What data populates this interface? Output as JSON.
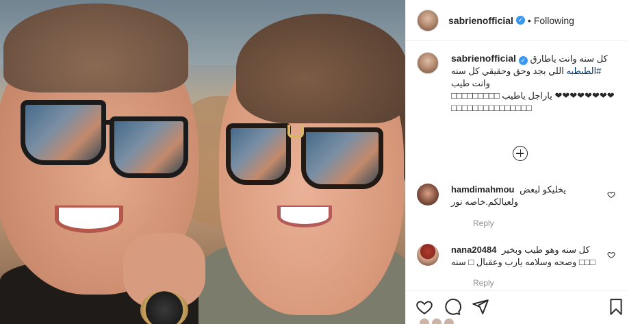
{
  "post": {
    "username": "sabrienofficial",
    "follow_status": "Following",
    "separator": "•",
    "verified_mark": "✓"
  },
  "caption": {
    "username": "sabrienofficial",
    "line1": "كل سنه وانت ياطارق",
    "hashtag": "#الطبطبه",
    "line2": "اللي بجد وحق وحقيقي كل سنه وانت طيب",
    "line3": "❤❤❤❤❤❤❤❤ ياراجل ياطيب",
    "line3_prefix": "□□□□□□□□□",
    "line4": "□□□□□□□□□□□□□□□"
  },
  "comments": [
    {
      "username": "hamdimahmou",
      "text": "يخليكو لبعض ولعيالكم.خاصه نور",
      "reply_label": "Reply"
    },
    {
      "username": "nana20484",
      "text": "كل سنه وهو طيب وبخير □□□ وصحه وسلامه يارب وعقبال □ سنه",
      "reply_label": "Reply"
    }
  ],
  "icons": {
    "like": "heart-icon",
    "comment": "comment-icon",
    "share": "share-icon",
    "save": "bookmark-icon",
    "add": "plus-circle-icon"
  },
  "colors": {
    "verified": "#3897f0",
    "hashtag": "#00376b",
    "muted": "#8e8e8e",
    "border": "#efefef"
  }
}
